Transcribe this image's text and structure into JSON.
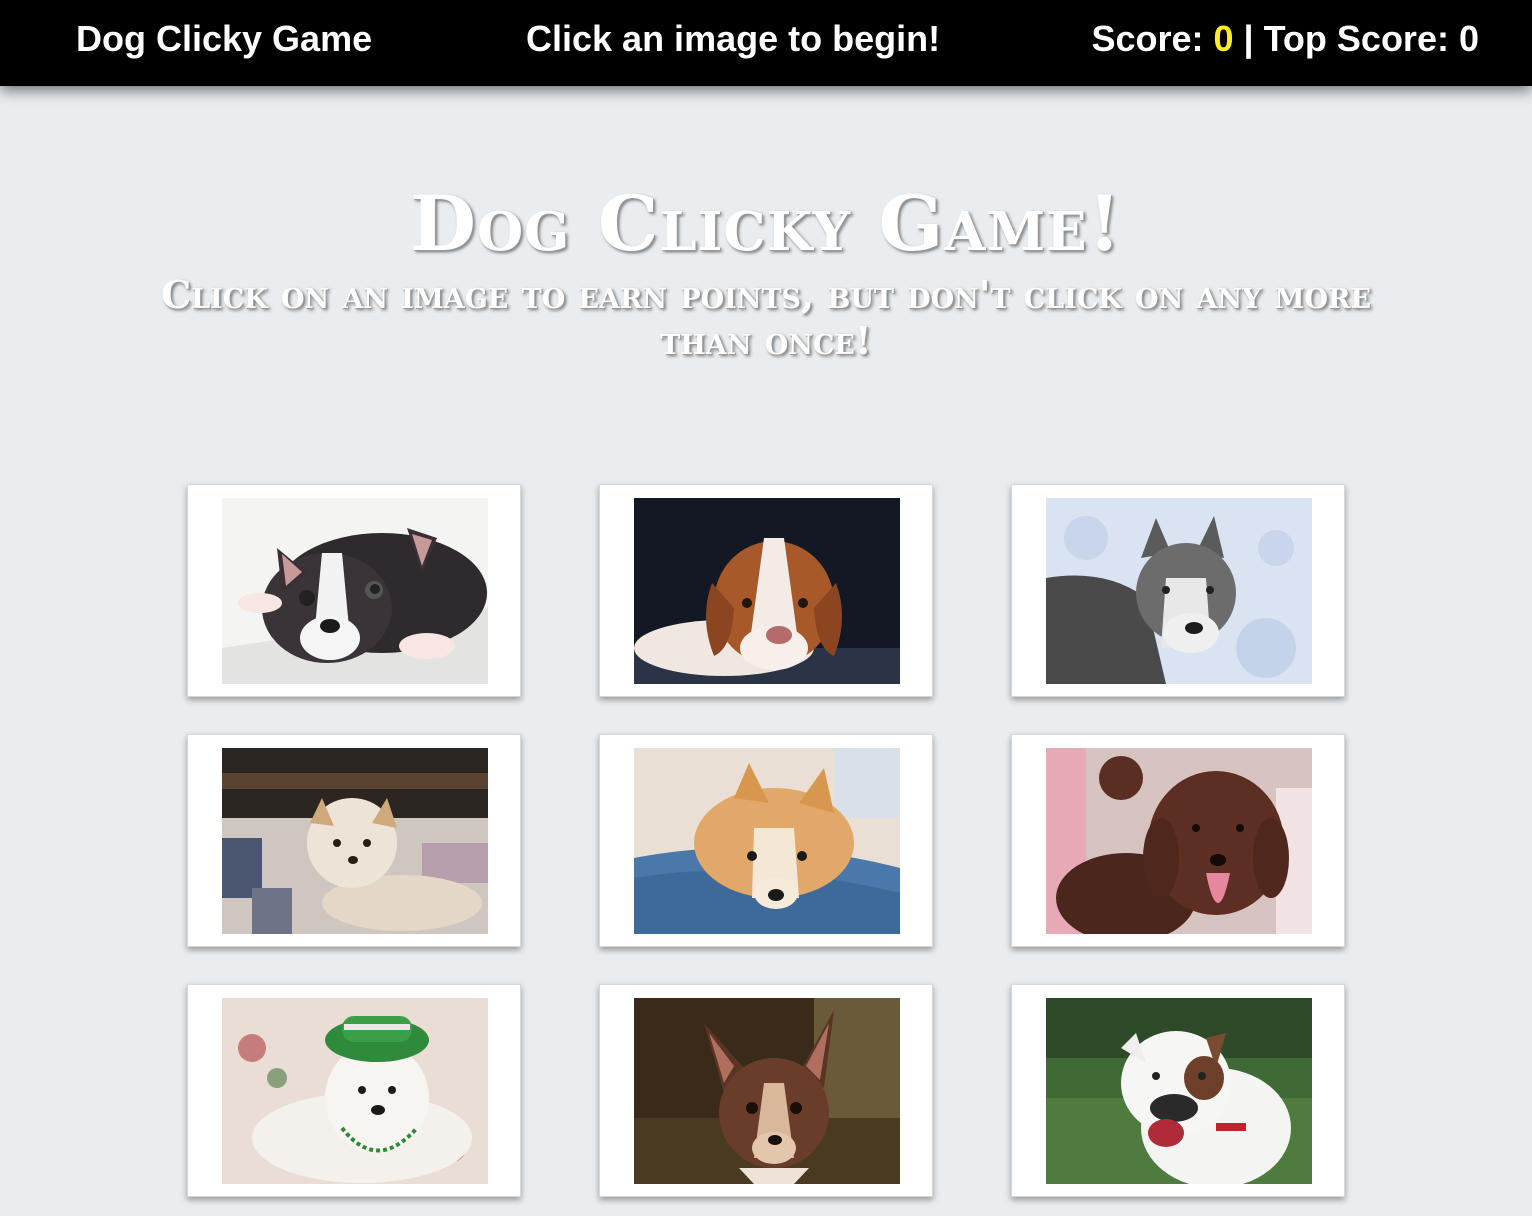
{
  "navbar": {
    "brand": "Dog Clicky Game",
    "message": "Click an image to begin!",
    "score_label": "Score: ",
    "score": "0",
    "separator": " | ",
    "top_score_label": "Top Score: ",
    "top_score": "0",
    "score_color": "#ffee22"
  },
  "hero": {
    "title": "Dog Clicky Game!",
    "subtitle": "Click on an image to earn points, but don't click on any more than once!"
  },
  "cards": [
    {
      "icon": "boston-terrier-puppy-photo"
    },
    {
      "icon": "beagle-puppy-photo"
    },
    {
      "icon": "husky-in-snow-photo"
    },
    {
      "icon": "terrier-on-bed-photo"
    },
    {
      "icon": "pomeranian-on-pillow-photo"
    },
    {
      "icon": "brown-poodle-photo"
    },
    {
      "icon": "white-dog-in-green-hat-photo"
    },
    {
      "icon": "chihuahua-photo"
    },
    {
      "icon": "white-boxer-photo"
    }
  ]
}
